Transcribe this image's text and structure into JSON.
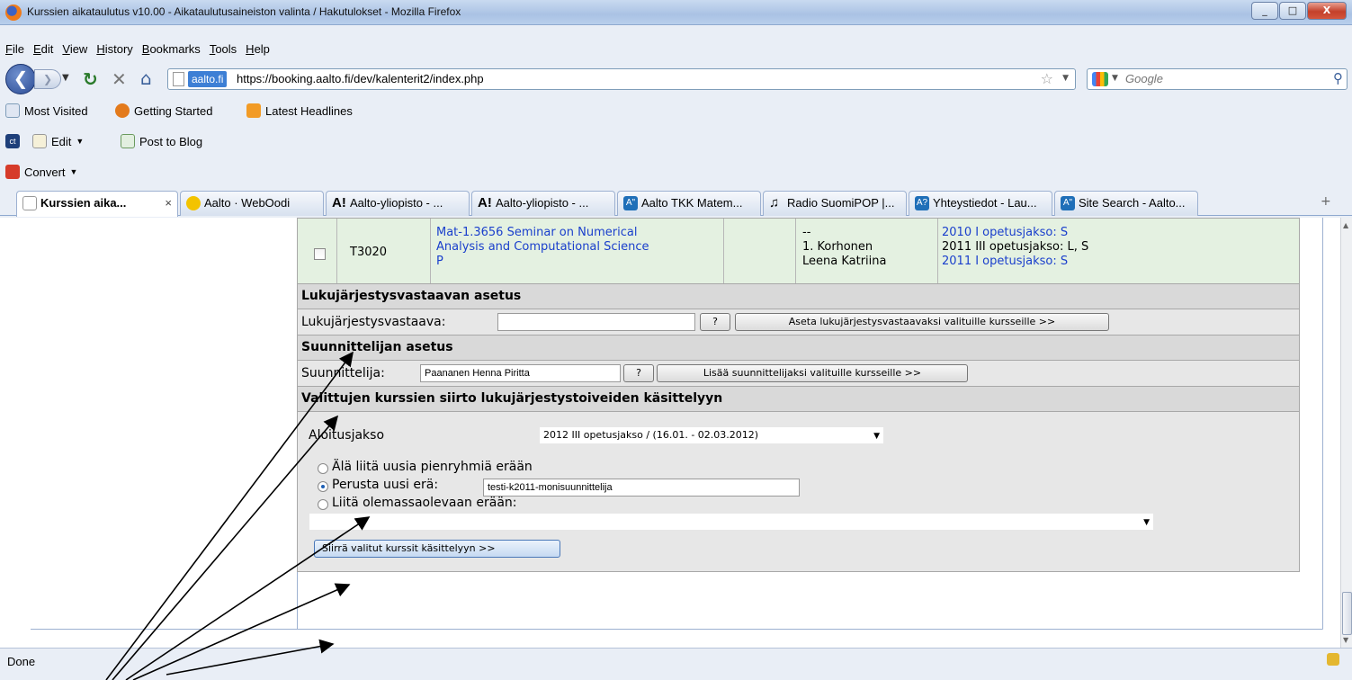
{
  "window": {
    "title": "Kurssien aikataulutus v10.00 - Aikataulutusaineiston valinta / Hakutulokset - Mozilla Firefox",
    "controls": {
      "minimize": "_",
      "maximize": "□",
      "close": "X"
    }
  },
  "menu": [
    "File",
    "Edit",
    "View",
    "History",
    "Bookmarks",
    "Tools",
    "Help"
  ],
  "nav": {
    "site_label": "aalto.fi",
    "url": "https://booking.aalto.fi/dev/kalenterit2/index.php",
    "search_placeholder": "Google"
  },
  "bookmarks": [
    "Most Visited",
    "Getting Started",
    "Latest Headlines"
  ],
  "toolbar2": {
    "edit": "Edit",
    "post": "Post to Blog"
  },
  "toolbar3": {
    "convert": "Convert"
  },
  "tabs": [
    {
      "label": "Kurssien aika...",
      "active": true
    },
    {
      "label": "Aalto · WebOodi"
    },
    {
      "label": "Aalto-yliopisto - ..."
    },
    {
      "label": "Aalto-yliopisto - ..."
    },
    {
      "label": "Aalto TKK Matem..."
    },
    {
      "label": "Radio SuomiPOP |..."
    },
    {
      "label": "Yhteystiedot - Lau..."
    },
    {
      "label": "Site Search - Aalto..."
    }
  ],
  "course": {
    "code": "T3020",
    "name_lines": [
      "Mat-1.3656 Seminar on Numerical",
      "Analysis and Computational Science",
      "P"
    ],
    "teacher_lines": [
      "--",
      "1. Korhonen",
      "Leena Katriina"
    ],
    "period_lines": [
      "2010 I opetusjakso: S",
      "2011 III opetusjakso: L, S",
      "2011 I opetusjakso: S"
    ]
  },
  "responsible_section": {
    "heading": "Lukujärjestysvastaavan asetus",
    "label": "Lukujärjestysvastaava:",
    "value": "",
    "help": "?",
    "button": "Aseta lukujärjestysvastaavaksi valituille kursseille >>"
  },
  "planner_section": {
    "heading": "Suunnittelijan asetus",
    "label": "Suunnittelija:",
    "value": "Paananen Henna Piritta",
    "help": "?",
    "button": "Lisää suunnittelijaksi valituille kursseille >>"
  },
  "transfer_section": {
    "heading": "Valittujen kurssien siirto lukujärjestystoiveiden käsittelyyn",
    "start_label": "Aloitusjakso",
    "start_value": "2012 III opetusjakso / (16.01. - 02.03.2012)",
    "radio1": "Älä liitä uusia pienryhmiä erään",
    "radio2": "Perusta uusi erä:",
    "radio2_value": "testi-k2011-monisuunnittelija",
    "radio3": "Liitä olemassaolevaan erään:",
    "existing_value": "",
    "submit": "Siirrä valitut kurssit käsittelyyn >>"
  },
  "status": {
    "text": "Done"
  }
}
